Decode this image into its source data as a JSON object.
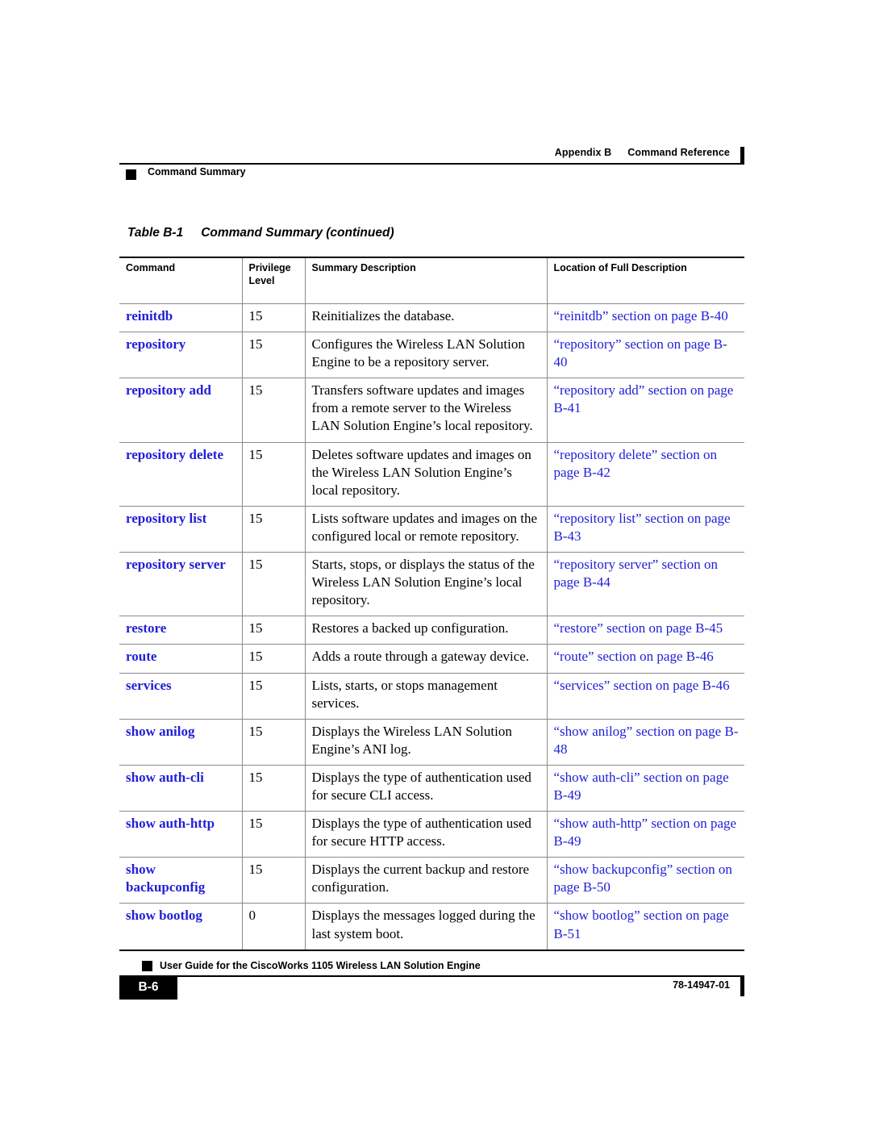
{
  "page": {
    "running_header": {
      "appendix": "Appendix B",
      "chapter_title": "Command Reference",
      "section_marker": "Command Summary"
    },
    "running_footer": {
      "guide_title": "User Guide for the CiscoWorks 1105 Wireless LAN Solution Engine",
      "page_number": "B-6",
      "doc_number": "78-14947-01"
    }
  },
  "table": {
    "caption_number": "Table B-1",
    "caption_title": "Command Summary (continued)",
    "headers": {
      "command": {
        "line1": "",
        "line2": "Command"
      },
      "privilege_level": {
        "line1": "Privilege",
        "line2": "Level"
      },
      "summary": {
        "line1": "",
        "line2": "Summary Description"
      },
      "location": {
        "line1": "",
        "line2": "Location of Full Description"
      }
    },
    "link_color": "#2020d8",
    "rows": [
      {
        "command": "reinitdb",
        "level": "15",
        "summary": "Reinitializes the database.",
        "location": "“reinitdb” section on page B-40"
      },
      {
        "command": "repository",
        "level": "15",
        "summary": "Configures the Wireless LAN Solution Engine to be a repository server.",
        "location": "“repository” section on page B-40"
      },
      {
        "command": "repository add",
        "level": "15",
        "summary": "Transfers software updates and images from a remote server to the Wireless LAN Solution Engine’s local repository.",
        "location": "“repository add” section on page B-41"
      },
      {
        "command": "repository delete",
        "level": "15",
        "summary": "Deletes software updates and images on the Wireless LAN Solution Engine’s local repository.",
        "location": "“repository delete” section on page B-42"
      },
      {
        "command": "repository list",
        "level": "15",
        "summary": "Lists software updates and images on the configured local or remote repository.",
        "location": "“repository list” section on page B-43"
      },
      {
        "command": "repository server",
        "level": "15",
        "summary": "Starts, stops, or displays the status of the Wireless LAN Solution Engine’s local repository.",
        "location": "“repository server” section on page B-44"
      },
      {
        "command": "restore",
        "level": "15",
        "summary": "Restores a backed up configuration.",
        "location": "“restore” section on page B-45"
      },
      {
        "command": "route",
        "level": "15",
        "summary": "Adds a route through a gateway device.",
        "location": "“route” section on page B-46"
      },
      {
        "command": "services",
        "level": "15",
        "summary": "Lists, starts, or stops management services.",
        "location": "“services” section on page B-46"
      },
      {
        "command": "show anilog",
        "level": "15",
        "summary": "Displays the Wireless LAN Solution Engine’s ANI log.",
        "location": "“show anilog” section on page B-48"
      },
      {
        "command": "show auth-cli",
        "level": "15",
        "summary": "Displays the type of authentication used for secure CLI access.",
        "location": "“show auth-cli” section on page B-49"
      },
      {
        "command": "show auth-http",
        "level": "15",
        "summary": "Displays the type of authentication used for secure HTTP access.",
        "location": "“show auth-http” section on page B-49"
      },
      {
        "command": "show backupconfig",
        "level": "15",
        "summary": "Displays the current backup and restore configuration.",
        "location": "“show backupconfig” section on page B-50"
      },
      {
        "command": "show bootlog",
        "level": "0",
        "summary": "Displays the messages logged during the last system boot.",
        "location": "“show bootlog” section on page B-51"
      }
    ]
  }
}
